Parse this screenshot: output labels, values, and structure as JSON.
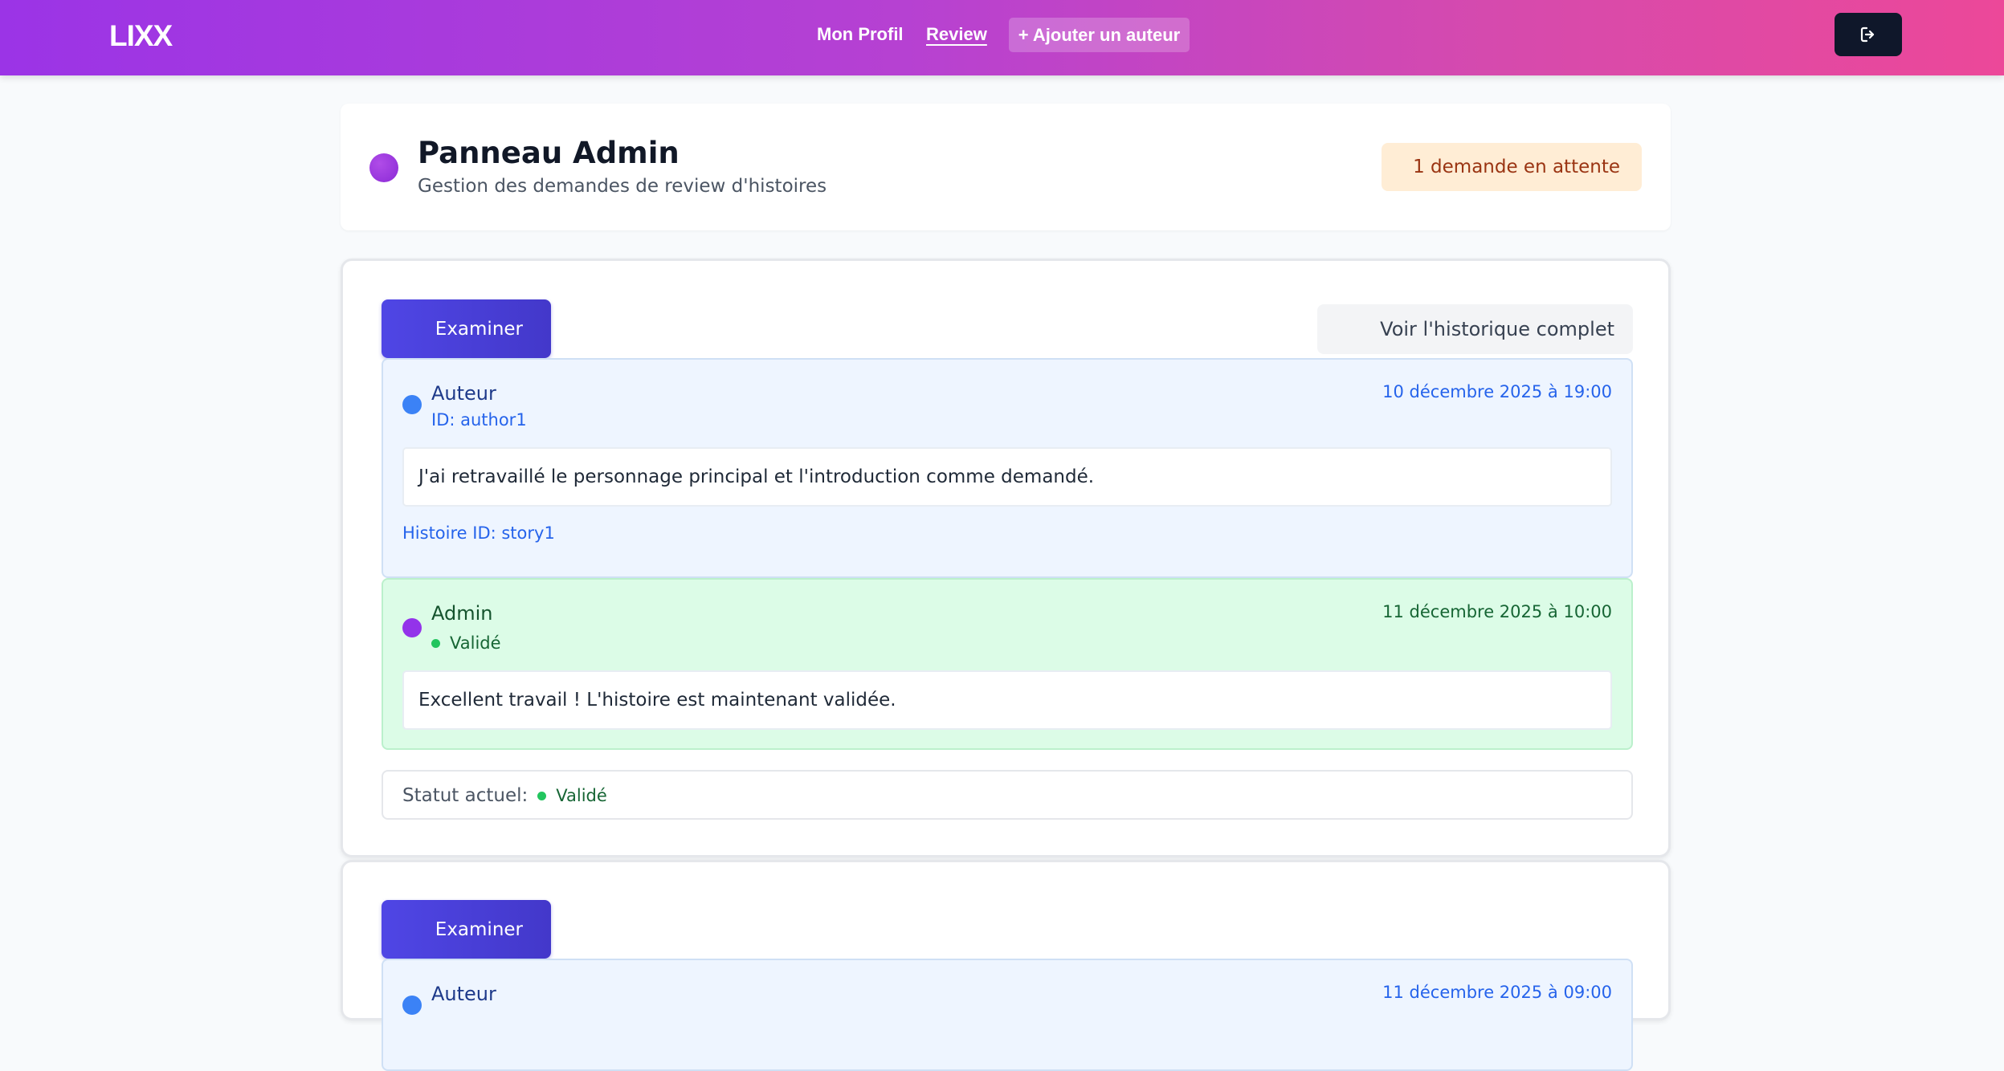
{
  "navbar": {
    "logo": "LIXX",
    "links": {
      "profile": "Mon Profil",
      "review": "Review"
    },
    "add_author": "+ Ajouter un auteur",
    "logout_icon": "logout-icon"
  },
  "header": {
    "title": "Panneau Admin",
    "subtitle": "Gestion des demandes de review d'histoires",
    "pending_badge": "1 demande en attente"
  },
  "colors": {
    "nav_gradient_start": "#9b34e6",
    "nav_gradient_end": "#ec4899",
    "primary_button": "#4f46e5",
    "author_bg": "#eef5ff",
    "admin_bg": "#dcfce7",
    "validated_green": "#22c55e",
    "pending_bg": "#ffedd5"
  },
  "reviews": [
    {
      "examine_label": "Examiner",
      "history_label": "Voir l'historique complet",
      "author_message": {
        "role": "Auteur",
        "id_text": "ID: author1",
        "date": "10 décembre 2025 à 19:00",
        "body": "J'ai retravaillé le personnage principal et l'introduction comme demandé.",
        "story_id": "Histoire ID: story1"
      },
      "admin_message": {
        "role": "Admin",
        "status": "Validé",
        "date": "11 décembre 2025 à 10:00",
        "body": "Excellent travail ! L'histoire est maintenant validée."
      },
      "status_label": "Statut actuel:",
      "status_value": "Validé"
    },
    {
      "examine_label": "Examiner",
      "author_message": {
        "role": "Auteur",
        "date": "11 décembre 2025 à 09:00"
      }
    }
  ]
}
